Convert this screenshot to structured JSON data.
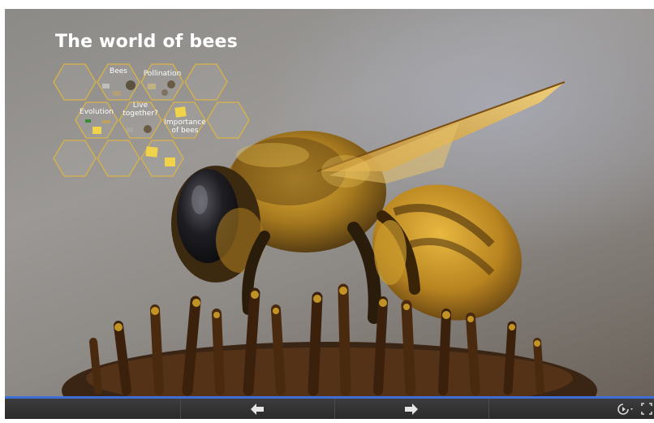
{
  "presentation": {
    "title": "The world of bees",
    "hexagons": [
      {
        "label": "Bees"
      },
      {
        "label": "Pollination"
      },
      {
        "label": "Evolution"
      },
      {
        "label": "Live\ntogether?"
      },
      {
        "label": "Importance\nof bees"
      }
    ]
  },
  "controls": {
    "prev_icon": "arrow-left-icon",
    "next_icon": "arrow-right-icon",
    "autoplay_icon": "autoplay-icon",
    "fullscreen_icon": "fullscreen-icon"
  },
  "colors": {
    "accent": "#3d6fd6",
    "hex_outline": "#d9b347",
    "bar": "#333333"
  }
}
